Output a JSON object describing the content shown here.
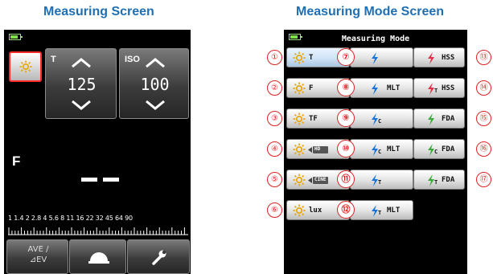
{
  "headings": {
    "left": "Measuring Screen",
    "right": "Measuring Mode Screen"
  },
  "colors": {
    "heading": "#1f6fb2",
    "screen_bg": "#000000",
    "callout": "#e02020",
    "ambient_icon": "#e8a400",
    "flash_blue": "#1a73d9",
    "flash_pink": "#e0304a",
    "flash_green": "#3aa83a",
    "battery": "#7fe14a",
    "highlight_border": "#ff2a2a"
  },
  "measuring": {
    "mode_icon": "sun-icon",
    "t_label": "T",
    "t_value": "125",
    "iso_label": "ISO",
    "iso_value": "100",
    "f_label": "F",
    "reading": "——",
    "scale_labels": "1 1.4 2 2.8 4 5.6 8 11 16 22 32 45 64 90",
    "ave_label_1": "AVE /",
    "ave_label_2": "⊿EV",
    "dome_icon": "dome-icon",
    "settings_icon": "wrench-icon"
  },
  "mode_screen": {
    "title": "Measuring Mode",
    "left_column": [
      {
        "num": "①",
        "text": "T",
        "icon": "sun-icon"
      },
      {
        "num": "②",
        "text": "F",
        "icon": "sun-icon"
      },
      {
        "num": "③",
        "text": "TF",
        "icon": "sun-icon"
      },
      {
        "num": "④",
        "text": "HD",
        "icon": "sun-icon"
      },
      {
        "num": "⑤",
        "text": "CINE",
        "icon": "sun-icon"
      },
      {
        "num": "⑥",
        "text": "lux",
        "icon": "sun-icon"
      }
    ],
    "middle_column": [
      {
        "num": "⑦",
        "text": "",
        "sub": ""
      },
      {
        "num": "⑧",
        "text": "MLT",
        "sub": ""
      },
      {
        "num": "⑨",
        "text": "",
        "sub": "C"
      },
      {
        "num": "⑩",
        "text": "MLT",
        "sub": "C"
      },
      {
        "num": "⑪",
        "text": "",
        "sub": "T"
      },
      {
        "num": "⑫",
        "text": "MLT",
        "sub": "T"
      }
    ],
    "right_column": [
      {
        "num": "⑬",
        "text": "HSS",
        "sub": "",
        "color": "pink"
      },
      {
        "num": "⑭",
        "text": "HSS",
        "sub": "T",
        "color": "pink"
      },
      {
        "num": "⑮",
        "text": "FDA",
        "sub": "",
        "color": "green"
      },
      {
        "num": "⑯",
        "text": "FDA",
        "sub": "C",
        "color": "green"
      },
      {
        "num": "⑰",
        "text": "FDA",
        "sub": "T",
        "color": "green"
      }
    ]
  }
}
